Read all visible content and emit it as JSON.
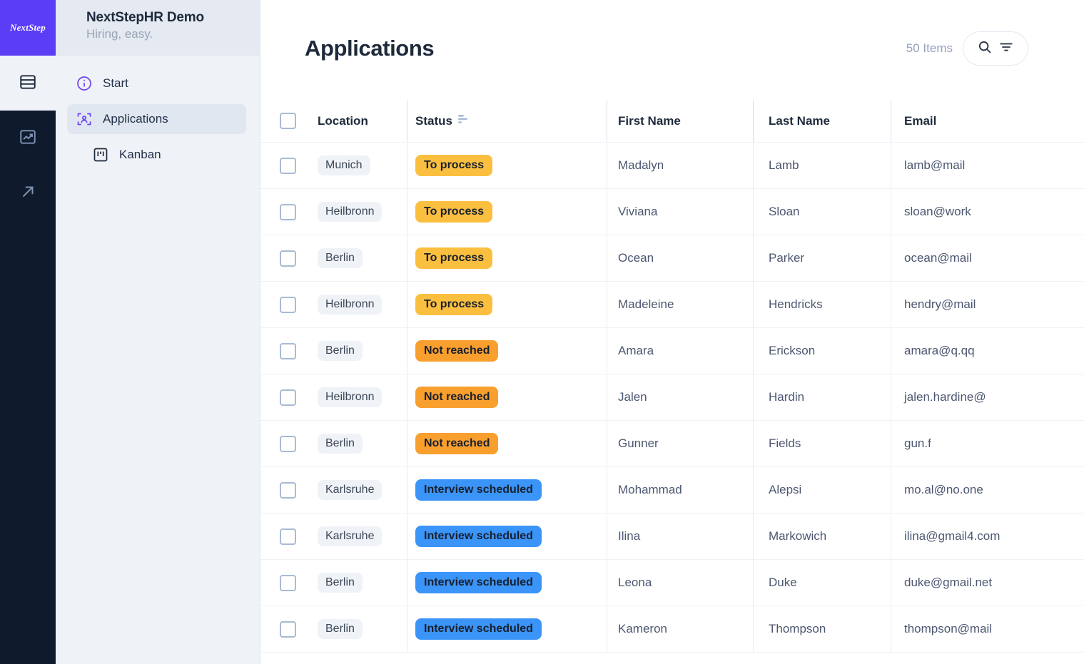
{
  "brand": {
    "logo_text": "NextStep"
  },
  "sidebar": {
    "title": "NextStepHR Demo",
    "subtitle": "Hiring, easy.",
    "items": [
      {
        "label": "Start",
        "icon": "info-circle-icon",
        "active": false,
        "sub": false
      },
      {
        "label": "Applications",
        "icon": "user-scan-icon",
        "active": true,
        "sub": false
      },
      {
        "label": "Kanban",
        "icon": "kanban-board-icon",
        "active": false,
        "sub": true
      }
    ]
  },
  "rail": {
    "buttons": [
      {
        "name": "table-view-icon"
      },
      {
        "name": "analytics-icon"
      },
      {
        "name": "external-link-icon"
      }
    ]
  },
  "header": {
    "title": "Applications",
    "items_count": "50 Items",
    "search_icon": "search-icon",
    "filter_icon": "filter-icon"
  },
  "table": {
    "columns": [
      {
        "key": "location",
        "label": "Location",
        "sorted": false
      },
      {
        "key": "status",
        "label": "Status",
        "sorted": true
      },
      {
        "key": "first_name",
        "label": "First Name",
        "sorted": false
      },
      {
        "key": "last_name",
        "label": "Last Name",
        "sorted": false
      },
      {
        "key": "email",
        "label": "Email",
        "sorted": false
      }
    ],
    "status_colors": {
      "To process": "#FBBF3F",
      "Not reached": "#F99F2E",
      "Interview scheduled": "#3B94F8"
    },
    "rows": [
      {
        "checked": false,
        "location": "Munich",
        "status": "To process",
        "first_name": "Madalyn",
        "last_name": "Lamb",
        "email": "lamb@mail"
      },
      {
        "checked": false,
        "location": "Heilbronn",
        "status": "To process",
        "first_name": "Viviana",
        "last_name": "Sloan",
        "email": "sloan@work"
      },
      {
        "checked": false,
        "location": "Berlin",
        "status": "To process",
        "first_name": "Ocean",
        "last_name": "Parker",
        "email": "ocean@mail"
      },
      {
        "checked": false,
        "location": "Heilbronn",
        "status": "To process",
        "first_name": "Madeleine",
        "last_name": "Hendricks",
        "email": "hendry@mail"
      },
      {
        "checked": false,
        "location": "Berlin",
        "status": "Not reached",
        "first_name": "Amara",
        "last_name": "Erickson",
        "email": "amara@q.qq"
      },
      {
        "checked": false,
        "location": "Heilbronn",
        "status": "Not reached",
        "first_name": "Jalen",
        "last_name": "Hardin",
        "email": "jalen.hardine@"
      },
      {
        "checked": false,
        "location": "Berlin",
        "status": "Not reached",
        "first_name": "Gunner",
        "last_name": "Fields",
        "email": "gun.f"
      },
      {
        "checked": false,
        "location": "Karlsruhe",
        "status": "Interview scheduled",
        "first_name": "Mohammad",
        "last_name": "Alepsi",
        "email": "mo.al@no.one"
      },
      {
        "checked": false,
        "location": "Karlsruhe",
        "status": "Interview scheduled",
        "first_name": "Ilina",
        "last_name": "Markowich",
        "email": "ilina@gmail4.com"
      },
      {
        "checked": false,
        "location": "Berlin",
        "status": "Interview scheduled",
        "first_name": "Leona",
        "last_name": "Duke",
        "email": "duke@gmail.net"
      },
      {
        "checked": false,
        "location": "Berlin",
        "status": "Interview scheduled",
        "first_name": "Kameron",
        "last_name": "Thompson",
        "email": "thompson@mail"
      }
    ]
  },
  "colors": {
    "brand_purple": "#5B3DF5",
    "rail_dark": "#0F1B2D",
    "sidebar_bg": "#EFF2F7",
    "text_dark": "#1E2A3B",
    "text_muted": "#93A2BC"
  }
}
